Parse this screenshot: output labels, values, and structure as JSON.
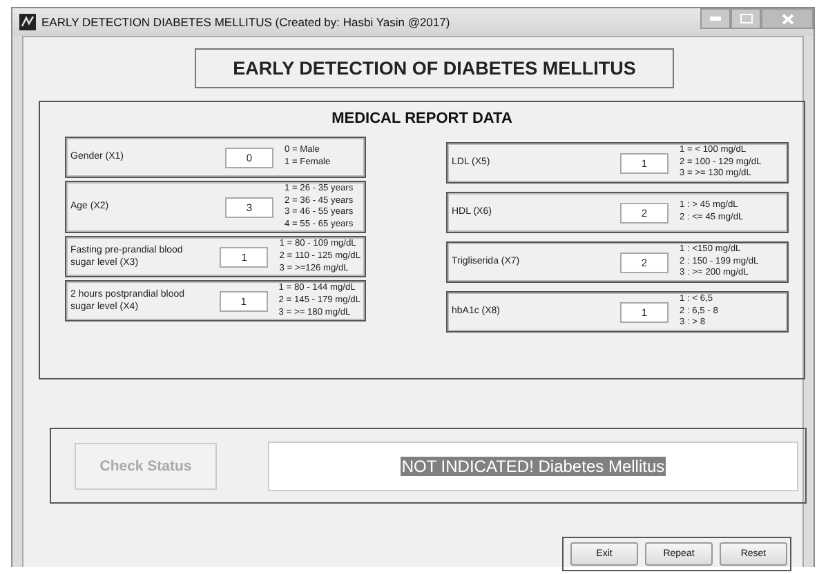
{
  "window": {
    "title": "EARLY DETECTION DIABETES MELLITUS (Created by: Hasbi Yasin @2017)"
  },
  "heading": "EARLY DETECTION OF DIABETES MELLITUS",
  "report": {
    "title": "MEDICAL REPORT DATA",
    "left": [
      {
        "label": "Gender (X1)",
        "value": "0",
        "legend": [
          "0 = Male",
          "1 = Female"
        ]
      },
      {
        "label": "Age (X2)",
        "value": "3",
        "legend": [
          "1 = 26 - 35 years",
          "2 = 36 - 45 years",
          "3 = 46 - 55 years",
          "4 = 55 - 65 years"
        ]
      },
      {
        "label": "Fasting pre-prandial blood sugar level (X3)",
        "value": "1",
        "legend": [
          "1 = 80 - 109 mg/dL",
          "2 = 110 - 125 mg/dL",
          "3 = >=126 mg/dL"
        ]
      },
      {
        "label": "2 hours postprandial blood sugar level (X4)",
        "value": "1",
        "legend": [
          "1 = 80 - 144 mg/dL",
          "2 = 145 - 179 mg/dL",
          "3 = >= 180 mg/dL"
        ]
      }
    ],
    "right": [
      {
        "label": "LDL (X5)",
        "value": "1",
        "legend": [
          "1 = < 100 mg/dL",
          "2 = 100 - 129 mg/dL",
          "3 = >= 130 mg/dL"
        ]
      },
      {
        "label": "HDL (X6)",
        "value": "2",
        "legend": [
          "1 : > 45 mg/dL",
          "2 : <= 45 mg/dL"
        ]
      },
      {
        "label": "Trigliserida (X7)",
        "value": "2",
        "legend": [
          "1 : <150 mg/dL",
          "2 : 150 - 199 mg/dL",
          "3 : >= 200 mg/dL"
        ]
      },
      {
        "label": "hbA1c (X8)",
        "value": "1",
        "legend": [
          "1 : < 6,5",
          "2 : 6,5 - 8",
          "3 : > 8"
        ]
      }
    ]
  },
  "status": {
    "button": {
      "label": "Check Status",
      "disabled": true
    },
    "result": {
      "text": "NOT INDICATED! Diabetes Mellitus",
      "highlighted": true
    }
  },
  "buttons": [
    "Exit",
    "Repeat",
    "Reset"
  ]
}
